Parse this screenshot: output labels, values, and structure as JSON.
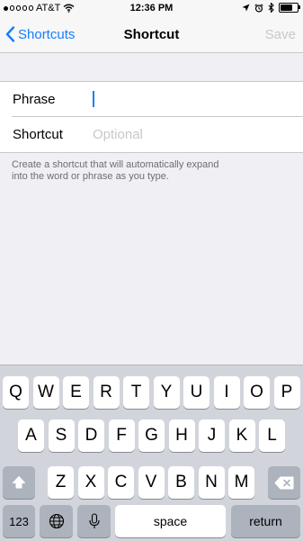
{
  "status_bar": {
    "carrier": "AT&T",
    "time": "12:36 PM",
    "signal_bars": 1,
    "battery_level": 0.75,
    "icons": [
      "signal-dots-icon",
      "wifi-icon",
      "location-icon",
      "alarm-icon",
      "bluetooth-icon",
      "battery-icon"
    ]
  },
  "nav": {
    "back_label": "Shortcuts",
    "title": "Shortcut",
    "save_label": "Save"
  },
  "form": {
    "phrase_label": "Phrase",
    "phrase_value": "",
    "shortcut_label": "Shortcut",
    "shortcut_placeholder": "Optional",
    "note": "Create a shortcut that will automatically expand into the word or phrase as you type."
  },
  "keyboard": {
    "row1": [
      "Q",
      "W",
      "E",
      "R",
      "T",
      "Y",
      "U",
      "I",
      "O",
      "P"
    ],
    "row2": [
      "A",
      "S",
      "D",
      "F",
      "G",
      "H",
      "J",
      "K",
      "L"
    ],
    "row3": [
      "Z",
      "X",
      "C",
      "V",
      "B",
      "N",
      "M"
    ],
    "numbers_label": "123",
    "space_label": "space",
    "return_label": "return"
  },
  "colors": {
    "accent": "#157efb",
    "disabled": "#c7c7cc",
    "background": "#efeff4",
    "keyboard_bg": "#d1d5db"
  }
}
